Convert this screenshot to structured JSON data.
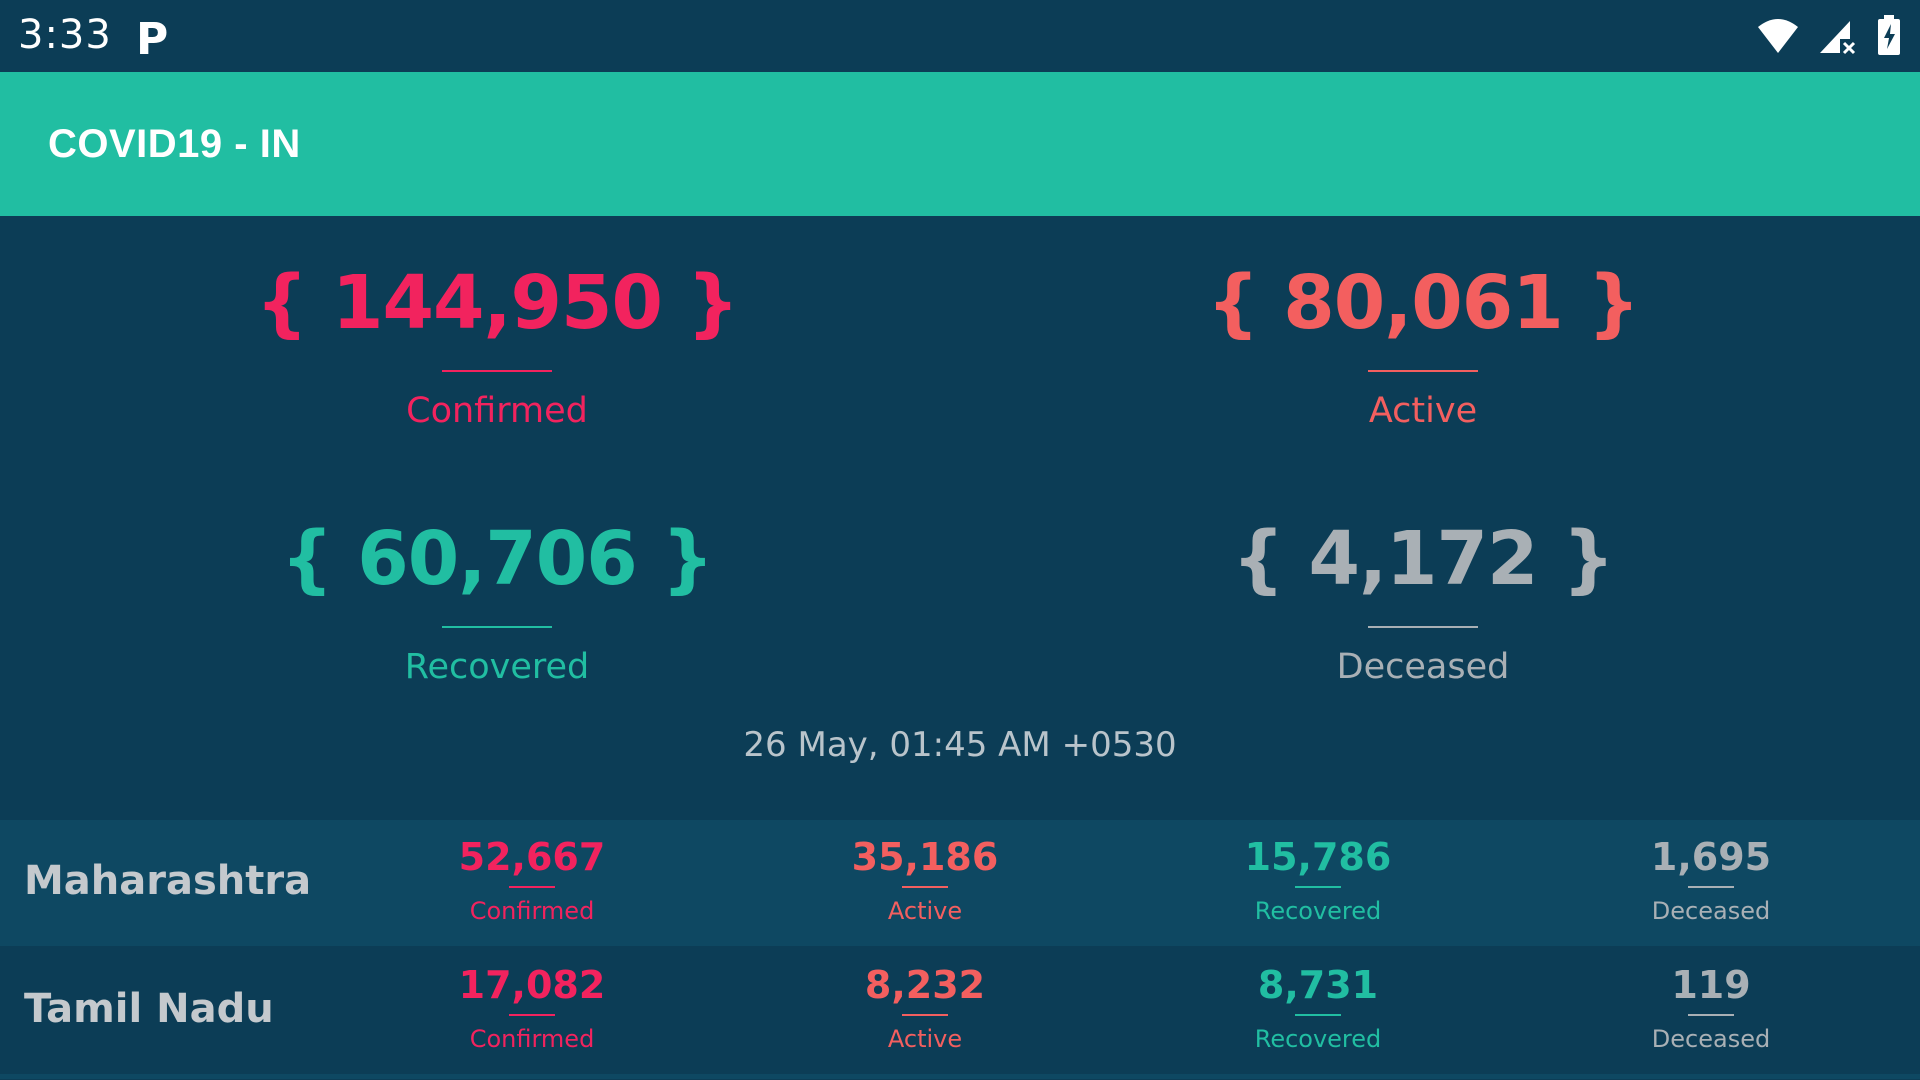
{
  "status_bar": {
    "time": "3:33",
    "notification_icon": "parking-icon",
    "icons": [
      "wifi-icon",
      "cellular-no-signal-icon",
      "battery-charging-icon"
    ]
  },
  "app_bar": {
    "title": "COVID19 - IN",
    "color": "#21bea2"
  },
  "colors": {
    "background": "#0c3d56",
    "row_alt": "#0e4862",
    "confirmed": "#f2235e",
    "active": "#f35f5f",
    "recovered": "#21bea2",
    "deceased": "#a9b0b5"
  },
  "summary": {
    "confirmed": {
      "value": "{ 144,950 }",
      "label": "Confirmed"
    },
    "active": {
      "value": "{ 80,061 }",
      "label": "Active"
    },
    "recovered": {
      "value": "{ 60,706 }",
      "label": "Recovered"
    },
    "deceased": {
      "value": "{ 4,172 }",
      "label": "Deceased"
    }
  },
  "last_updated": "26 May, 01:45 AM +0530",
  "states": [
    {
      "name": "Maharashtra",
      "confirmed": "52,667",
      "confirmed_label": "Confirmed",
      "active": "35,186",
      "active_label": "Active",
      "recovered": "15,786",
      "recovered_label": "Recovered",
      "deceased": "1,695",
      "deceased_label": "Deceased"
    },
    {
      "name": "Tamil Nadu",
      "confirmed": "17,082",
      "confirmed_label": "Confirmed",
      "active": "8,232",
      "active_label": "Active",
      "recovered": "8,731",
      "recovered_label": "Recovered",
      "deceased": "119",
      "deceased_label": "Deceased"
    }
  ]
}
